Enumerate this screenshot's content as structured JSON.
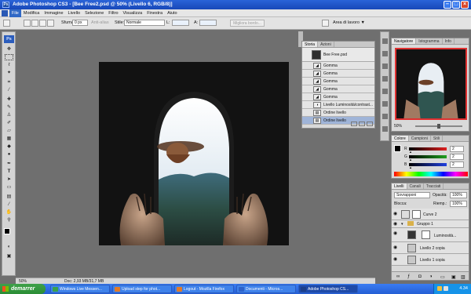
{
  "window": {
    "title": "Adobe Photoshop CS3 - [Bee Free2.psd @ 50% (Livello 6, RGB/8)]",
    "app_icon_text": "Ps"
  },
  "menu": {
    "items": [
      "File",
      "Modifica",
      "Immagine",
      "Livello",
      "Selezione",
      "Filtro",
      "Visualizza",
      "Finestra",
      "Aiuto"
    ],
    "active": "File"
  },
  "options_bar": {
    "sfuma_label": "Sfuma:",
    "sfuma_value": "0 px",
    "antialias_label": "Anti-alias",
    "stile_label": "Stile:",
    "stile_value": "Normale",
    "larg_label": "L:",
    "alt_label": "A:",
    "refine_label": "Migliora bordo...",
    "workspace_label": "Area di lavoro ▼"
  },
  "status_bar": {
    "zoom": "50%",
    "doc_info": "Doc: 2,93 MB/31,7 MB"
  },
  "history_panel": {
    "tabs": [
      "Storia",
      "Azioni"
    ],
    "active_tab": "Storia",
    "snapshot_name": "Bee Free.psd",
    "items": [
      "Gomma",
      "Gomma",
      "Gomma",
      "Gomma",
      "Gomma",
      "Livello Luminosità/contrast...",
      "Ordine livello",
      "Ordine livello"
    ]
  },
  "navigator_panel": {
    "tabs": [
      "Navigatore",
      "Istogramma",
      "Info"
    ],
    "active_tab": "Navigatore",
    "zoom": "50%",
    "zoom_level": 0.5
  },
  "color_panel": {
    "tabs": [
      "Colore",
      "Campioni",
      "Stili"
    ],
    "active_tab": "Colore",
    "channels": [
      {
        "label": "R",
        "value": "2",
        "color": "#e02020",
        "level": 0.01
      },
      {
        "label": "G",
        "value": "2",
        "color": "#20a020",
        "level": 0.01
      },
      {
        "label": "B",
        "value": "2",
        "color": "#2040e0",
        "level": 0.01
      }
    ]
  },
  "layers_panel": {
    "tabs": [
      "Livelli",
      "Canali",
      "Tracciati"
    ],
    "active_tab": "Livelli",
    "blend_mode": "Sovrapponi",
    "opacity_label": "Opacità:",
    "opacity_value": "100%",
    "lock_label": "Blocca:",
    "fill_label": "Riemp.:",
    "fill_value": "100%",
    "layers": [
      {
        "name": "Curve 2",
        "type": "adjustment"
      },
      {
        "name": "Gruppo 1",
        "type": "group"
      },
      {
        "name": "Luminosità...",
        "type": "adjustment"
      },
      {
        "name": "Livello 2 copia",
        "type": "pixel"
      },
      {
        "name": "Livello 1 copia",
        "type": "pixel"
      }
    ]
  },
  "taskbar": {
    "start_label": "demarrer",
    "tasks": [
      {
        "label": "Windows Live Messen...",
        "active": false
      },
      {
        "label": "Upload step for phot...",
        "active": false
      },
      {
        "label": "Logout - Mozilla Firefox",
        "active": false
      },
      {
        "label": "Documenti - Micros...",
        "active": false
      },
      {
        "label": "Adobe Photoshop CS...",
        "active": true
      }
    ],
    "clock": "4.34"
  },
  "colors": {
    "titlebar": "#1f55cf",
    "taskbar": "#245ed4",
    "workspace": "#6f6f6f",
    "navigator_frame": "#e03030"
  }
}
